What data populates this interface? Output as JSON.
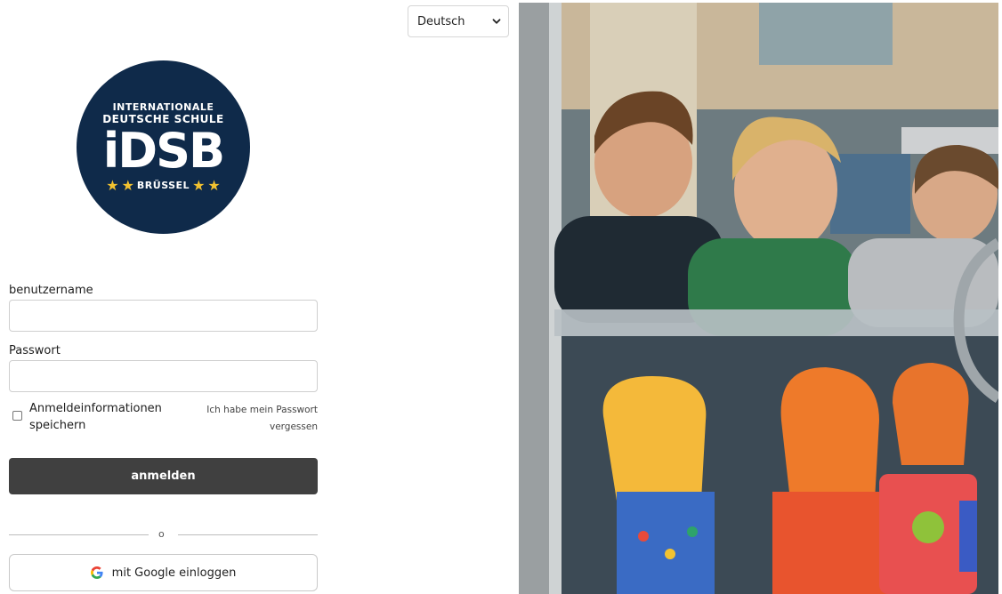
{
  "language": {
    "selected": "Deutsch"
  },
  "logo": {
    "line1": "INTERNATIONALE",
    "line2": "DEUTSCHE SCHULE",
    "acronym": "iDSB",
    "city": "BRÜSSEL",
    "bg_color": "#0f2a4a",
    "star_color": "#f2c230"
  },
  "form": {
    "username_label": "benutzername",
    "username_value": "",
    "password_label": "Passwort",
    "password_value": "",
    "remember_label": "Anmeldeinformationen speichern",
    "forgot_label": "Ich habe mein Passwort vergessen",
    "login_label": "anmelden",
    "divider_text": "o",
    "google_label": "mit Google einloggen"
  },
  "colors": {
    "login_button": "#404040",
    "border": "#cfcfcf"
  }
}
